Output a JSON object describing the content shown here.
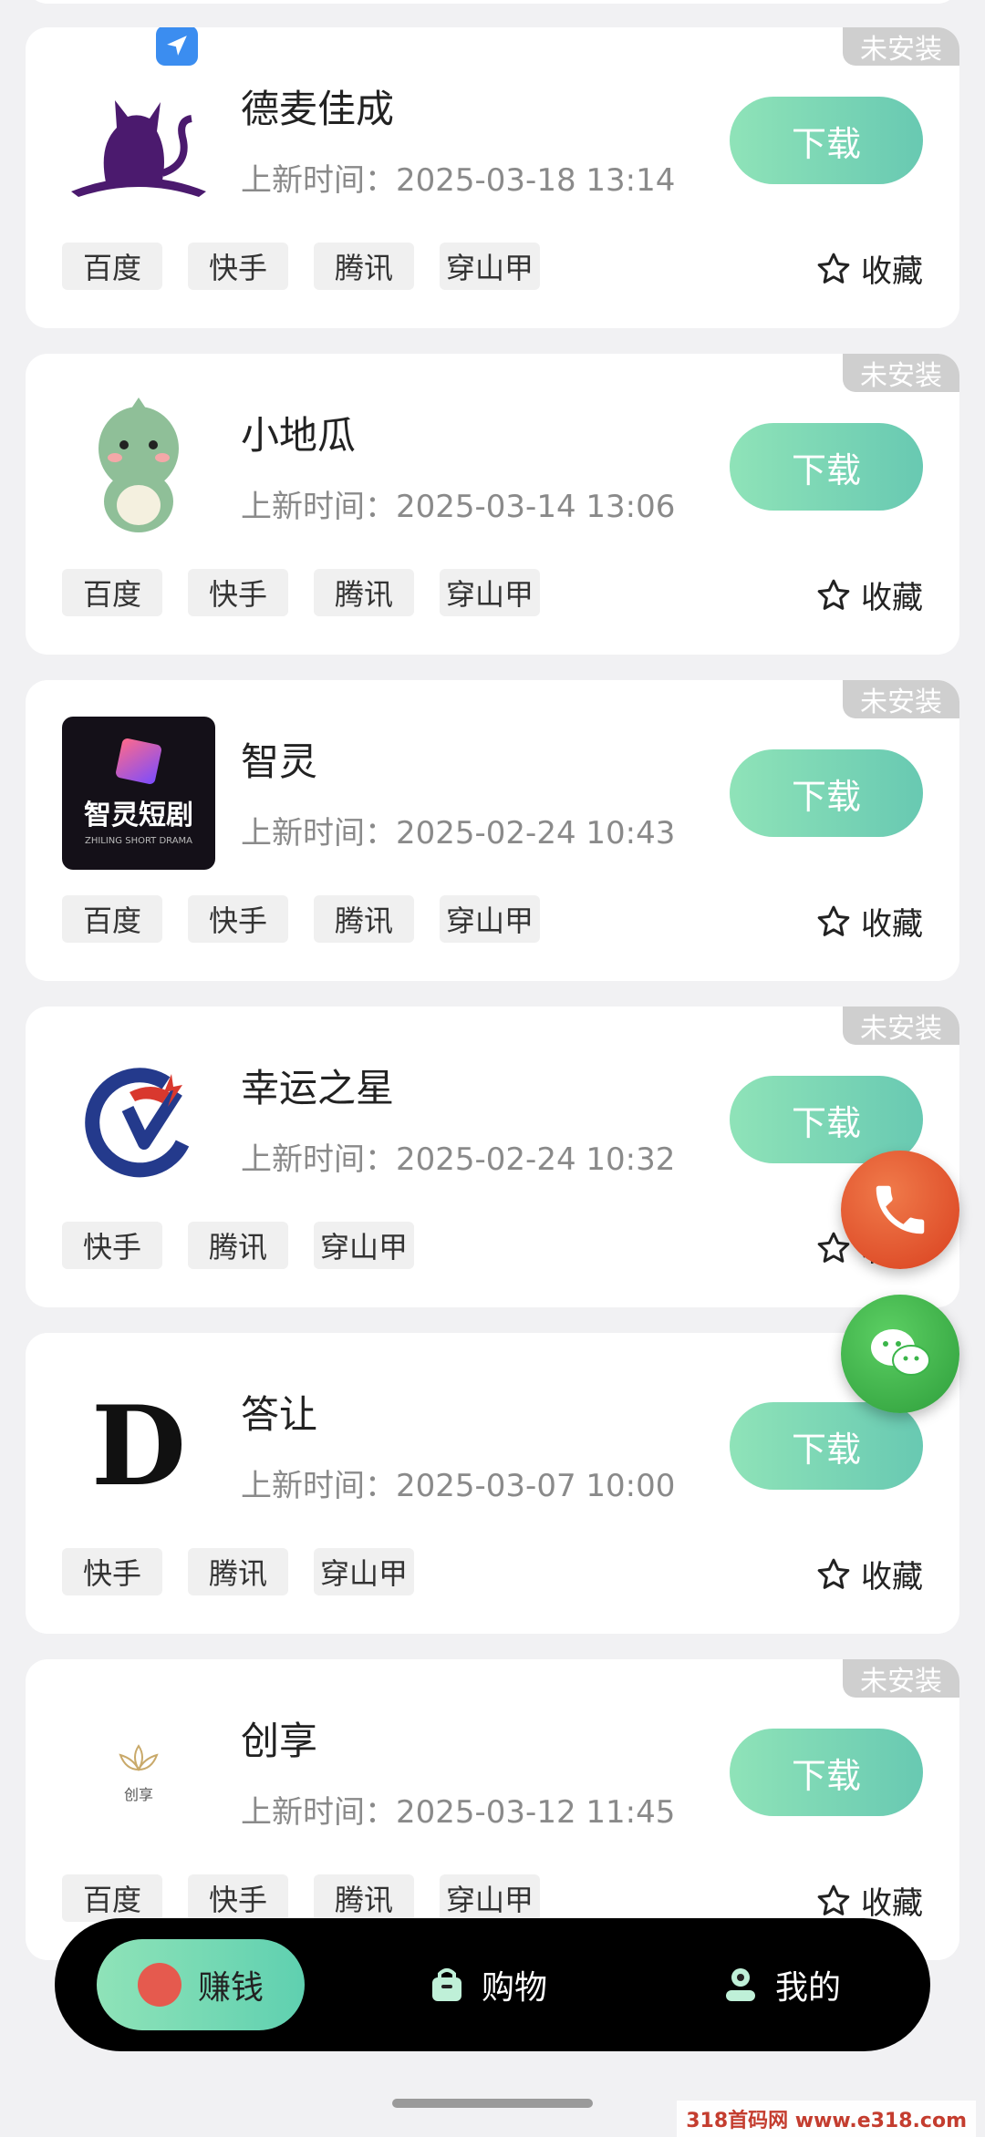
{
  "apps": [
    {
      "name": "德麦佳成",
      "time": "上新时间：2025-03-18 13:14",
      "badge": "未安装",
      "download": "下载",
      "tags": [
        "百度",
        "快手",
        "腾讯",
        "穿山甲"
      ],
      "fav": "收藏",
      "logo": "cat-logo-icon"
    },
    {
      "name": "小地瓜",
      "time": "上新时间：2025-03-14 13:06",
      "badge": "未安装",
      "download": "下载",
      "tags": [
        "百度",
        "快手",
        "腾讯",
        "穿山甲"
      ],
      "fav": "收藏",
      "logo": "dinosaur-logo-icon"
    },
    {
      "name": "智灵",
      "time": "上新时间：2025-02-24 10:43",
      "badge": "未安装",
      "download": "下载",
      "tags": [
        "百度",
        "快手",
        "腾讯",
        "穿山甲"
      ],
      "fav": "收藏",
      "logo_text": "智灵短剧",
      "logo_sub": "ZHILING SHORT DRAMA"
    },
    {
      "name": "幸运之星",
      "time": "上新时间：2025-02-24 10:32",
      "badge": "未安装",
      "download": "下载",
      "tags": [
        "快手",
        "腾讯",
        "穿山甲"
      ],
      "fav": "收藏",
      "logo": "lucky-star-logo-icon"
    },
    {
      "name": "答让",
      "time": "上新时间：2025-03-07 10:00",
      "badge": "",
      "download": "下载",
      "tags": [
        "快手",
        "腾讯",
        "穿山甲"
      ],
      "fav": "收藏",
      "logo_text": "D"
    },
    {
      "name": "创享",
      "time": "上新时间：2025-03-12 11:45",
      "badge": "未安装",
      "download": "下载",
      "tags": [
        "百度",
        "快手",
        "腾讯",
        "穿山甲"
      ],
      "fav": "收藏",
      "logo_text": "创享"
    }
  ],
  "nav": {
    "earn": "赚钱",
    "shop": "购物",
    "mine": "我的"
  },
  "watermark": "318首码网 www.e318.com",
  "colors": {
    "accent": "#6fd0b3",
    "badge": "#cfcfcf",
    "phone": "#e8532d",
    "wechat": "#3bb54a"
  }
}
